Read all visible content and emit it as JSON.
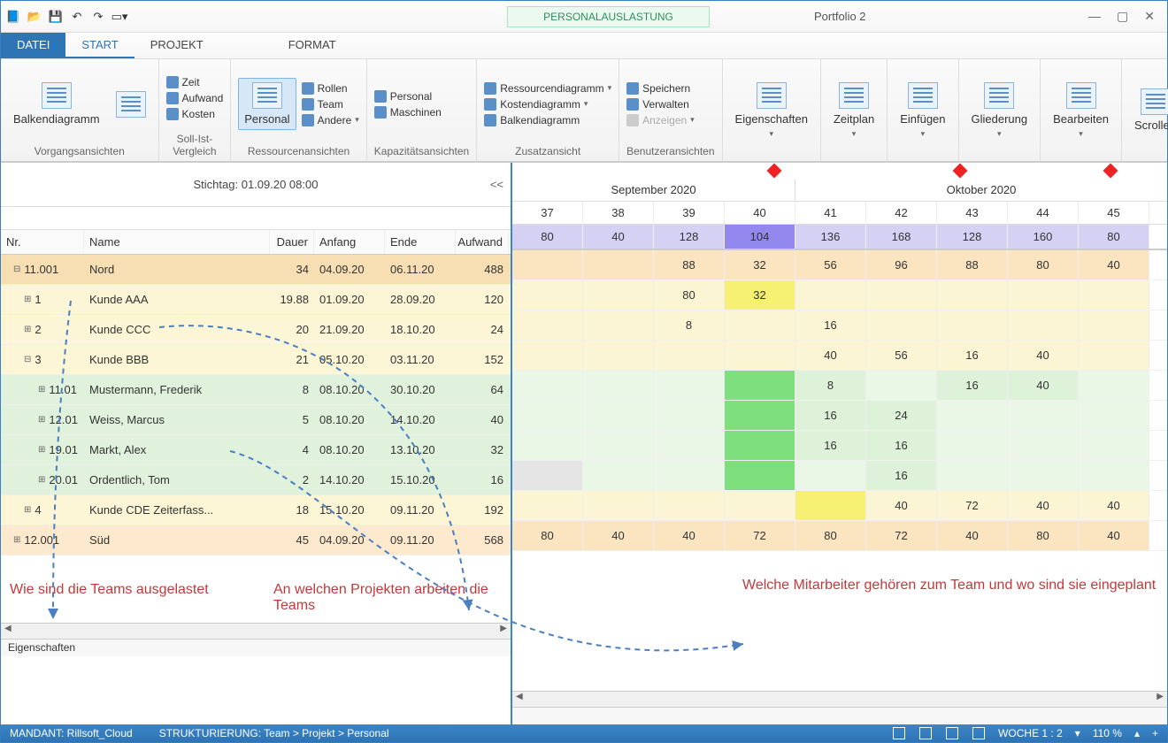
{
  "title": {
    "contextual": "PERSONALAUSLASTUNG",
    "document": "Portfolio 2"
  },
  "tabs": {
    "file": "DATEI",
    "start": "START",
    "projekt": "PROJEKT",
    "format": "FORMAT"
  },
  "ribbon": {
    "g1": {
      "label": "Vorgangsansichten",
      "btn": "Balkendiagramm"
    },
    "g2": {
      "label": "Soll-Ist-Vergleich",
      "i1": "Zeit",
      "i2": "Aufwand",
      "i3": "Kosten"
    },
    "g3": {
      "label": "Ressourcenansichten",
      "btn": "Personal",
      "i1": "Rollen",
      "i2": "Team",
      "i3": "Andere"
    },
    "g4": {
      "label": "Kapazitätsansichten",
      "i1": "Personal",
      "i2": "Maschinen"
    },
    "g5": {
      "label": "Zusatzansicht",
      "i1": "Ressourcendiagramm",
      "i2": "Kostendiagramm",
      "i3": "Balkendiagramm"
    },
    "g6": {
      "label": "Benutzeransichten",
      "i1": "Speichern",
      "i2": "Verwalten",
      "i3": "Anzeigen"
    },
    "g7": "Eigenschaften",
    "g8": "Zeitplan",
    "g9": "Einfügen",
    "g10": "Gliederung",
    "g11": "Bearbeiten",
    "g12": "Scrollen"
  },
  "stichtag": "Stichtag: 01.09.20 08:00",
  "collapse": "<<",
  "cols": {
    "nr": "Nr.",
    "name": "Name",
    "dauer": "Dauer",
    "anfang": "Anfang",
    "ende": "Ende",
    "aufwand": "Aufwand"
  },
  "rows": [
    {
      "lvl": "lvl0",
      "tree": "⊟",
      "nr": "11.001",
      "name": "Nord",
      "dauer": "34",
      "anfang": "04.09.20",
      "ende": "06.11.20",
      "aufwand": "488"
    },
    {
      "lvl": "lvl1",
      "tree": "⊞",
      "nr": "1",
      "name": "Kunde AAA",
      "dauer": "19.88",
      "anfang": "01.09.20",
      "ende": "28.09.20",
      "aufwand": "120"
    },
    {
      "lvl": "lvl1",
      "tree": "⊞",
      "nr": "2",
      "name": "Kunde CCC",
      "dauer": "20",
      "anfang": "21.09.20",
      "ende": "18.10.20",
      "aufwand": "24"
    },
    {
      "lvl": "lvl1",
      "tree": "⊟",
      "nr": "3",
      "name": "Kunde BBB",
      "dauer": "21",
      "anfang": "05.10.20",
      "ende": "03.11.20",
      "aufwand": "152"
    },
    {
      "lvl": "lvl2",
      "tree": "⊞",
      "nr": "11.01",
      "name": "Mustermann, Frederik",
      "dauer": "8",
      "anfang": "08.10.20",
      "ende": "30.10.20",
      "aufwand": "64"
    },
    {
      "lvl": "lvl2",
      "tree": "⊞",
      "nr": "12.01",
      "name": "Weiss, Marcus",
      "dauer": "5",
      "anfang": "08.10.20",
      "ende": "14.10.20",
      "aufwand": "40"
    },
    {
      "lvl": "lvl2",
      "tree": "⊞",
      "nr": "19.01",
      "name": "Markt, Alex",
      "dauer": "4",
      "anfang": "08.10.20",
      "ende": "13.10.20",
      "aufwand": "32"
    },
    {
      "lvl": "lvl2",
      "tree": "⊞",
      "nr": "20.01",
      "name": "Ordentlich, Tom",
      "dauer": "2",
      "anfang": "14.10.20",
      "ende": "15.10.20",
      "aufwand": "16"
    },
    {
      "lvl": "lvl1",
      "tree": "⊞",
      "nr": "4",
      "name": "Kunde CDE Zeiterfass...",
      "dauer": "18",
      "anfang": "15.10.20",
      "ende": "09.11.20",
      "aufwand": "192"
    },
    {
      "lvl": "lvl0b",
      "tree": "⊞",
      "nr": "12.001",
      "name": "Süd",
      "dauer": "45",
      "anfang": "04.09.20",
      "ende": "09.11.20",
      "aufwand": "568"
    }
  ],
  "months": {
    "m1": "September 2020",
    "m2": "Oktober 2020"
  },
  "weeks": [
    "37",
    "38",
    "39",
    "40",
    "41",
    "42",
    "43",
    "44",
    "45"
  ],
  "totals": [
    "80",
    "40",
    "128",
    "104",
    "136",
    "168",
    "128",
    "160",
    "80"
  ],
  "grid": [
    {
      "bg": "bg-o",
      "cells": [
        "",
        "",
        "88",
        "32",
        "56",
        "96",
        "88",
        "80",
        "40"
      ]
    },
    {
      "bg": "bg-y",
      "cells": [
        "",
        "",
        "80",
        "32",
        "",
        "",
        "",
        "",
        ""
      ],
      "hi": [
        3
      ]
    },
    {
      "bg": "bg-y",
      "cells": [
        "",
        "",
        "8",
        "",
        "16",
        "",
        "",
        "",
        ""
      ]
    },
    {
      "bg": "bg-y",
      "cells": [
        "",
        "",
        "",
        "",
        "40",
        "56",
        "16",
        "40",
        ""
      ]
    },
    {
      "bg": "bg-g",
      "cells": [
        "",
        "",
        "",
        "",
        "8",
        "",
        "16",
        "40",
        ""
      ],
      "hi2": [
        3
      ]
    },
    {
      "bg": "bg-g",
      "cells": [
        "",
        "",
        "",
        "",
        "16",
        "24",
        "",
        "",
        ""
      ],
      "hi2": [
        3
      ]
    },
    {
      "bg": "bg-g",
      "cells": [
        "",
        "",
        "",
        "",
        "16",
        "16",
        "",
        "",
        ""
      ],
      "hi2": [
        3
      ]
    },
    {
      "bg": "bg-g",
      "cells": [
        "",
        "",
        "",
        "",
        "",
        "16",
        "",
        "",
        ""
      ],
      "gr": [
        0
      ],
      "hi2": [
        3
      ]
    },
    {
      "bg": "bg-y",
      "cells": [
        "",
        "",
        "",
        "",
        "",
        "40",
        "72",
        "40",
        "40"
      ],
      "hi": [
        4
      ]
    },
    {
      "bg": "bg-o",
      "cells": [
        "80",
        "40",
        "40",
        "72",
        "80",
        "72",
        "40",
        "80",
        "40"
      ]
    }
  ],
  "annot": {
    "a1": "Wie sind die Teams ausgelastet",
    "a2": "An welchen Projekten arbeiten die Teams",
    "a3": "Welche Mitarbeiter gehören zum Team und wo sind sie eingeplant"
  },
  "eig": "Eigenschaften",
  "status": {
    "mandant": "MANDANT: Rillsoft_Cloud",
    "strukt": "STRUKTURIERUNG: Team  >  Projekt  >  Personal",
    "woche": "WOCHE 1 : 2",
    "zoom": "110 %",
    "plus": "+"
  }
}
